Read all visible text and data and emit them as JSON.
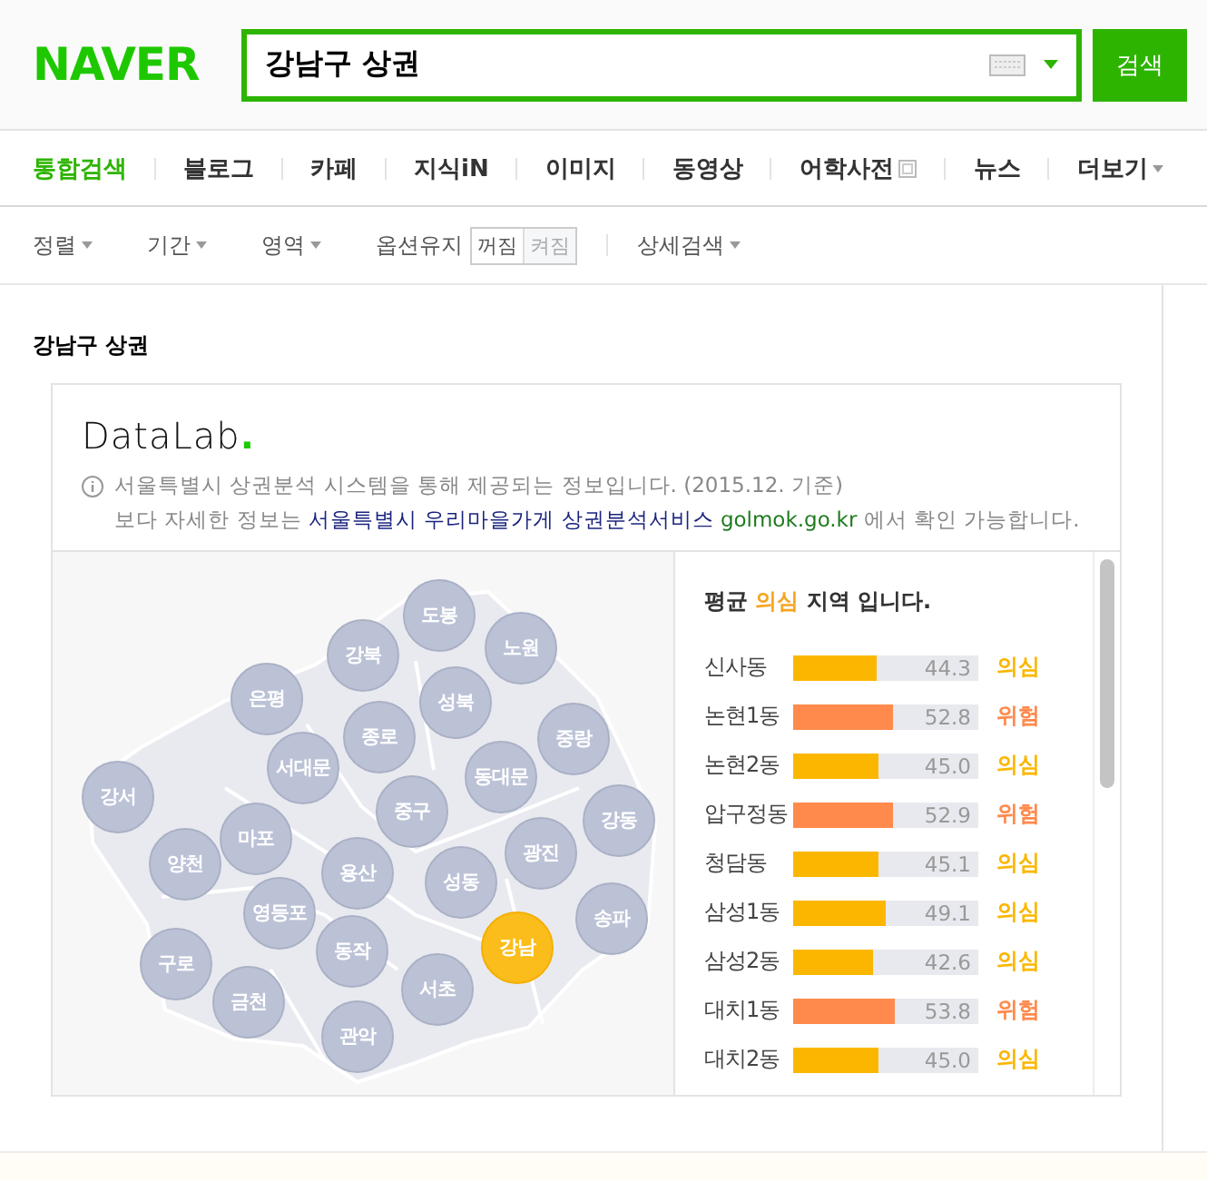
{
  "logo": "NAVER",
  "search": {
    "value": "강남구 상권",
    "button": "검색"
  },
  "tabs": [
    {
      "label": "통합검색",
      "selected": true,
      "kind": "plain"
    },
    {
      "label": "블로그",
      "selected": false,
      "kind": "plain"
    },
    {
      "label": "카페",
      "selected": false,
      "kind": "plain"
    },
    {
      "label": "지식iN",
      "selected": false,
      "kind": "plain"
    },
    {
      "label": "이미지",
      "selected": false,
      "kind": "plain"
    },
    {
      "label": "동영상",
      "selected": false,
      "kind": "plain"
    },
    {
      "label": "어학사전",
      "selected": false,
      "kind": "window"
    },
    {
      "label": "뉴스",
      "selected": false,
      "kind": "plain"
    },
    {
      "label": "더보기",
      "selected": false,
      "kind": "more"
    }
  ],
  "options": [
    {
      "label": "정렬",
      "kind": "menu"
    },
    {
      "label": "기간",
      "kind": "menu"
    },
    {
      "label": "영역",
      "kind": "menu"
    },
    {
      "label": "옵션유지",
      "kind": "toggle",
      "choices": [
        {
          "label": "꺼짐",
          "selected": true
        },
        {
          "label": "켜짐",
          "selected": false
        }
      ]
    },
    {
      "label": "상세검색",
      "kind": "menu"
    }
  ],
  "section_title": "강남구 상권",
  "datalab": {
    "logo": "DataLab",
    "logo_dot": ".",
    "notice": "서울특별시 상권분석 시스템을 통해 제공되는 정보입니다. (2015.12. 기준)",
    "more_before": "보다 자세한 정보는",
    "service_link": "서울특별시 우리마을가게 상권분석서비스",
    "site_link": "golmok.go.kr",
    "more_after": "에서 확인 가능합니다."
  },
  "map": {
    "districts": [
      {
        "name": "도봉",
        "selected": false
      },
      {
        "name": "노원",
        "selected": false
      },
      {
        "name": "강북",
        "selected": false
      },
      {
        "name": "성북",
        "selected": false
      },
      {
        "name": "은평",
        "selected": false
      },
      {
        "name": "종로",
        "selected": false
      },
      {
        "name": "중랑",
        "selected": false
      },
      {
        "name": "서대문",
        "selected": false
      },
      {
        "name": "동대문",
        "selected": false
      },
      {
        "name": "강서",
        "selected": false
      },
      {
        "name": "중구",
        "selected": false
      },
      {
        "name": "강동",
        "selected": false
      },
      {
        "name": "마포",
        "selected": false
      },
      {
        "name": "광진",
        "selected": false
      },
      {
        "name": "양천",
        "selected": false
      },
      {
        "name": "용산",
        "selected": false
      },
      {
        "name": "성동",
        "selected": false
      },
      {
        "name": "송파",
        "selected": false
      },
      {
        "name": "영등포",
        "selected": false
      },
      {
        "name": "동작",
        "selected": false
      },
      {
        "name": "강남",
        "selected": true
      },
      {
        "name": "구로",
        "selected": false
      },
      {
        "name": "서초",
        "selected": false
      },
      {
        "name": "금천",
        "selected": false
      },
      {
        "name": "관악",
        "selected": false
      }
    ]
  },
  "ranking": {
    "heading_before": "평균",
    "heading_highlight": "의심",
    "heading_after": "지역 입니다.",
    "rows": [
      {
        "name": "신사동",
        "value": "44.3",
        "level": 0.45,
        "status": "의심",
        "color": "#fbb700"
      },
      {
        "name": "논현1동",
        "value": "52.8",
        "level": 0.54,
        "status": "위험",
        "color": "#ff8a4c"
      },
      {
        "name": "논현2동",
        "value": "45.0",
        "level": 0.46,
        "status": "의심",
        "color": "#fbb700"
      },
      {
        "name": "압구정동",
        "value": "52.9",
        "level": 0.54,
        "status": "위험",
        "color": "#ff8a4c"
      },
      {
        "name": "청담동",
        "value": "45.1",
        "level": 0.46,
        "status": "의심",
        "color": "#fbb700"
      },
      {
        "name": "삼성1동",
        "value": "49.1",
        "level": 0.5,
        "status": "의심",
        "color": "#fbb700"
      },
      {
        "name": "삼성2동",
        "value": "42.6",
        "level": 0.43,
        "status": "의심",
        "color": "#fbb700"
      },
      {
        "name": "대치1동",
        "value": "53.8",
        "level": 0.55,
        "status": "위험",
        "color": "#ff8a4c"
      },
      {
        "name": "대치2동",
        "value": "45.0",
        "level": 0.46,
        "status": "의심",
        "color": "#fbb700"
      }
    ]
  }
}
